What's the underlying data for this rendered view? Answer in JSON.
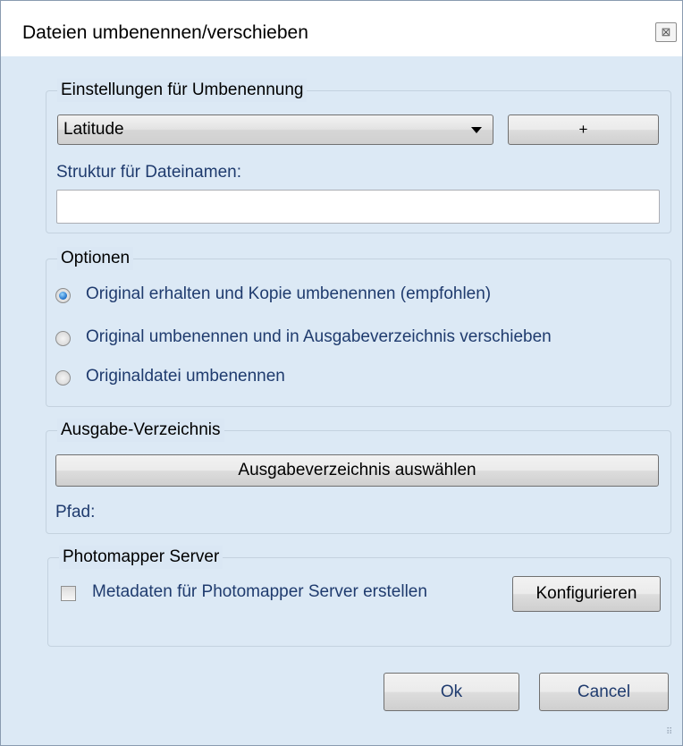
{
  "window": {
    "title": "Dateien umbenennen/verschieben",
    "close_glyph": "⊠"
  },
  "rename_settings": {
    "legend": "Einstellungen für Umbenennung",
    "preset_selected": "Latitude",
    "add_button_label": "+",
    "filename_structure_label": "Struktur für Dateinamen:",
    "filename_structure_value": ""
  },
  "options": {
    "legend": "Optionen",
    "items": [
      {
        "label": "Original erhalten und Kopie umbenennen (empfohlen)",
        "checked": true
      },
      {
        "label": "Original umbenennen und in Ausgabeverzeichnis verschieben",
        "checked": false
      },
      {
        "label": "Originaldatei umbenennen",
        "checked": false
      }
    ]
  },
  "output_dir": {
    "legend": "Ausgabe-Verzeichnis",
    "choose_button_label": "Ausgabeverzeichnis auswählen",
    "path_label": "Pfad:"
  },
  "photomapper": {
    "legend": "Photomapper Server",
    "checkbox_label": "Metadaten für Photomapper Server erstellen",
    "checkbox_checked": false,
    "configure_button_label": "Konfigurieren"
  },
  "footer": {
    "ok_label": "Ok",
    "cancel_label": "Cancel"
  },
  "colors": {
    "dialog_background": "#dae7f4",
    "label_text": "#1f3b6e",
    "radio_selected": "#1d6ec8"
  }
}
